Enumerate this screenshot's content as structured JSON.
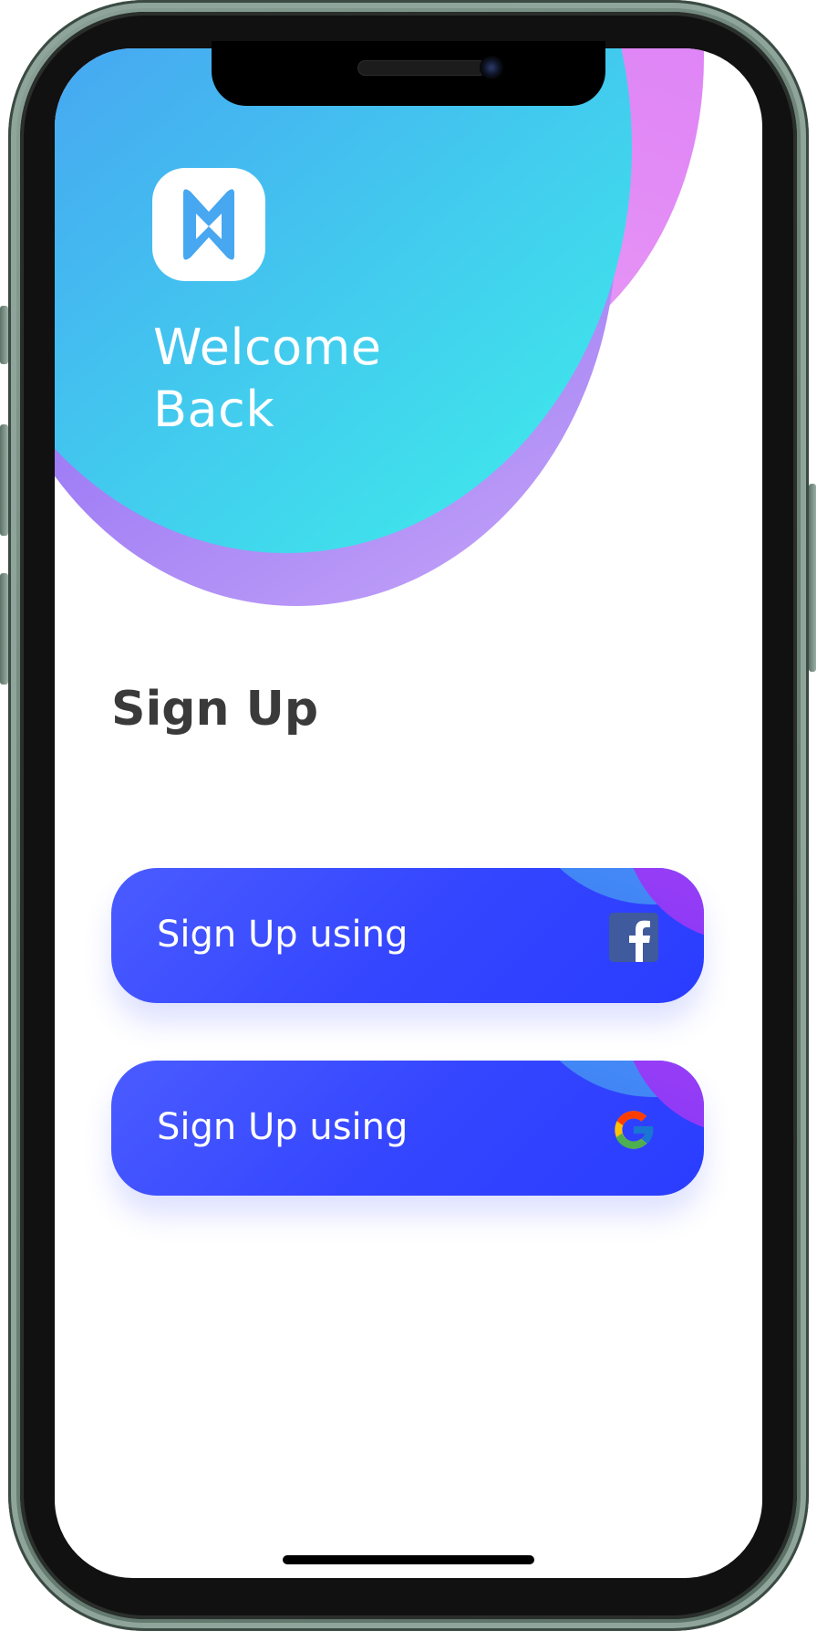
{
  "hero": {
    "welcome_line1": "Welcome",
    "welcome_line2": "Back",
    "logo_icon": "app-logo-icon"
  },
  "section": {
    "title": "Sign Up"
  },
  "buttons": [
    {
      "label": "Sign Up using",
      "icon": "facebook-icon"
    },
    {
      "label": "Sign Up using",
      "icon": "google-icon"
    }
  ],
  "colors": {
    "hero_cyan": "#3ef0ea",
    "hero_blue": "#4d8ef3",
    "hero_purple": "#8a63f3",
    "hero_pink": "#d97cf8",
    "button_blue": "#3546ff",
    "facebook_blue": "#3b5998",
    "title_text": "#3a3a3a",
    "phone_frame": "#6d8479"
  }
}
